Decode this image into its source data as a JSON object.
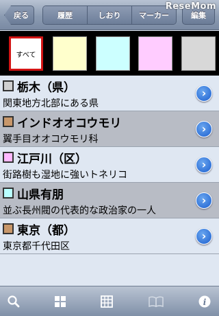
{
  "topbar": {
    "back_label": "戻る",
    "segments": [
      "履歴",
      "しおり",
      "マーカー"
    ],
    "edit_label": "編集",
    "watermark": "ReseMom"
  },
  "filter": {
    "all_label": "すべて",
    "colors": [
      "#ffffcc",
      "#ccffff",
      "#ffccff",
      "#d8d8d8"
    ],
    "selected_border": "#d21414"
  },
  "rows": [
    {
      "title": "栃木（県）",
      "subtitle": "関東地方北部にある県",
      "marker": "#d0d0d0"
    },
    {
      "title": "インドオオコウモリ",
      "subtitle": "翼手目オオコウモリ科",
      "marker": "#c8976a"
    },
    {
      "title": "江戸川（区）",
      "subtitle": "街路樹も湿地に強いトネリコ",
      "marker": "#ffb8ff"
    },
    {
      "title": "山県有朋",
      "subtitle": "並ぶ長州閥の代表的な政治家の一人",
      "marker": "#b9ffff"
    },
    {
      "title": "東京（都）",
      "subtitle": "東京都千代田区",
      "marker": "#c8976a"
    }
  ],
  "toolbar": {
    "icons": [
      "search-icon",
      "grid-icon",
      "table-icon",
      "book-icon",
      "info-icon"
    ]
  }
}
